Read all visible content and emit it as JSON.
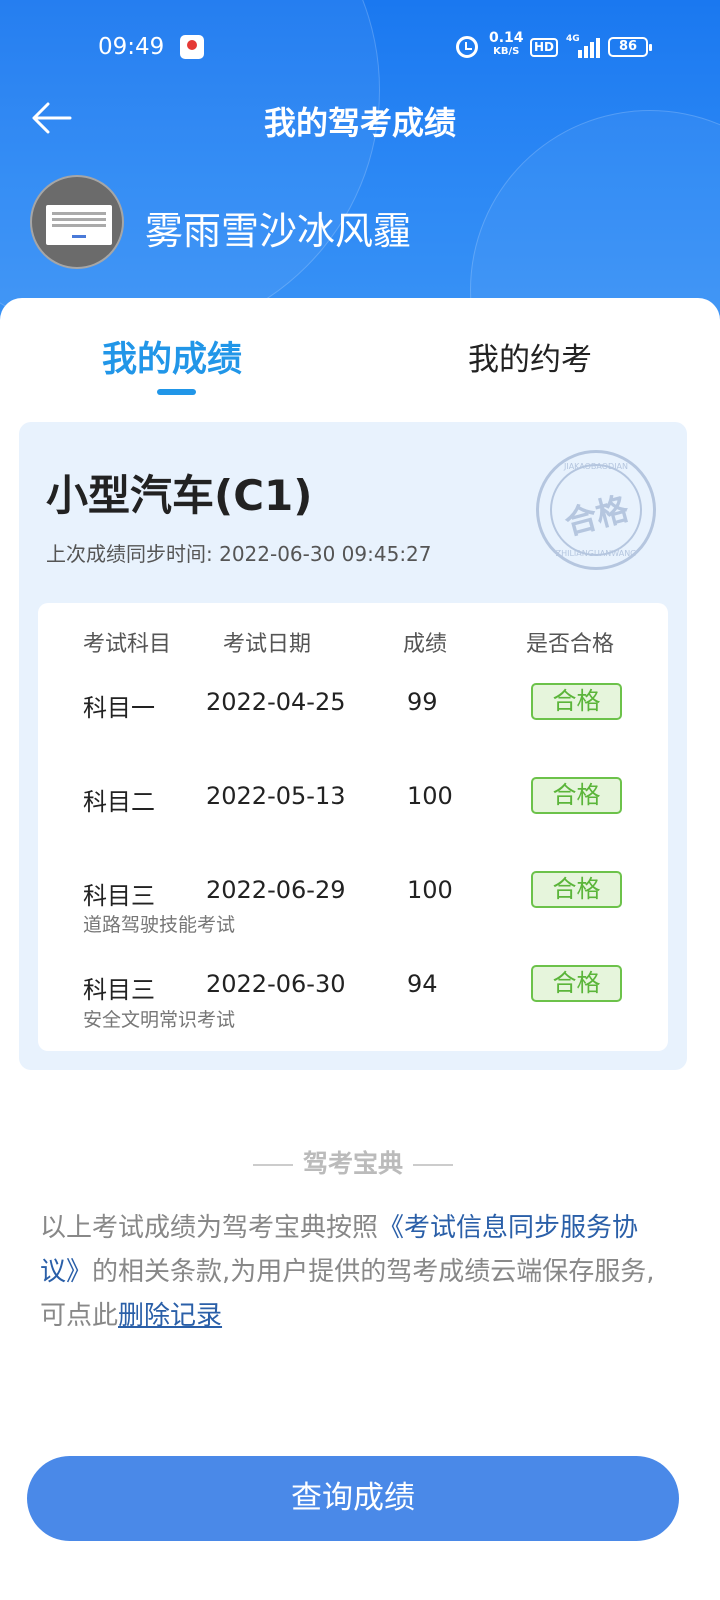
{
  "status_bar": {
    "time": "09:49",
    "speed_value": "0.14",
    "speed_unit": "KB/S",
    "hd": "HD",
    "network": "4G",
    "battery": "86"
  },
  "header": {
    "title": "我的驾考成绩",
    "username": "雾雨雪沙冰风霾"
  },
  "tabs": {
    "scores": "我的成绩",
    "appointments": "我的约考"
  },
  "license": {
    "type": "小型汽车(C1)",
    "sync_time": "上次成绩同步时间: 2022-06-30 09:45:27",
    "stamp": {
      "text": "合格",
      "arc_top": "JIAKAOBAODIAN",
      "arc_bottom": "ZHILIANGUANWANG"
    }
  },
  "table": {
    "headers": [
      "考试科目",
      "考试日期",
      "成绩",
      "是否合格"
    ],
    "rows": [
      {
        "subject": "科目一",
        "date": "2022-04-25",
        "score": "99",
        "result": "合格",
        "note": ""
      },
      {
        "subject": "科目二",
        "date": "2022-05-13",
        "score": "100",
        "result": "合格",
        "note": ""
      },
      {
        "subject": "科目三",
        "date": "2022-06-29",
        "score": "100",
        "result": "合格",
        "note": "道路驾驶技能考试"
      },
      {
        "subject": "科目三",
        "date": "2022-06-30",
        "score": "94",
        "result": "合格",
        "note": "安全文明常识考试"
      }
    ]
  },
  "footer": {
    "brand": "驾考宝典",
    "disclaimer_prefix": "以上考试成绩为驾考宝典按照",
    "agreement_link": "《考试信息同步服务协议》",
    "disclaimer_middle": "的相关条款,为用户提供的驾考成绩云端保存服务,可点此",
    "delete_link": "删除记录",
    "query_button": "查询成绩"
  },
  "colors": {
    "header_blue": "#1a78f0",
    "accent_blue": "#2196e8",
    "pass_green": "#5bb53a",
    "button_blue": "#4a89e8"
  }
}
